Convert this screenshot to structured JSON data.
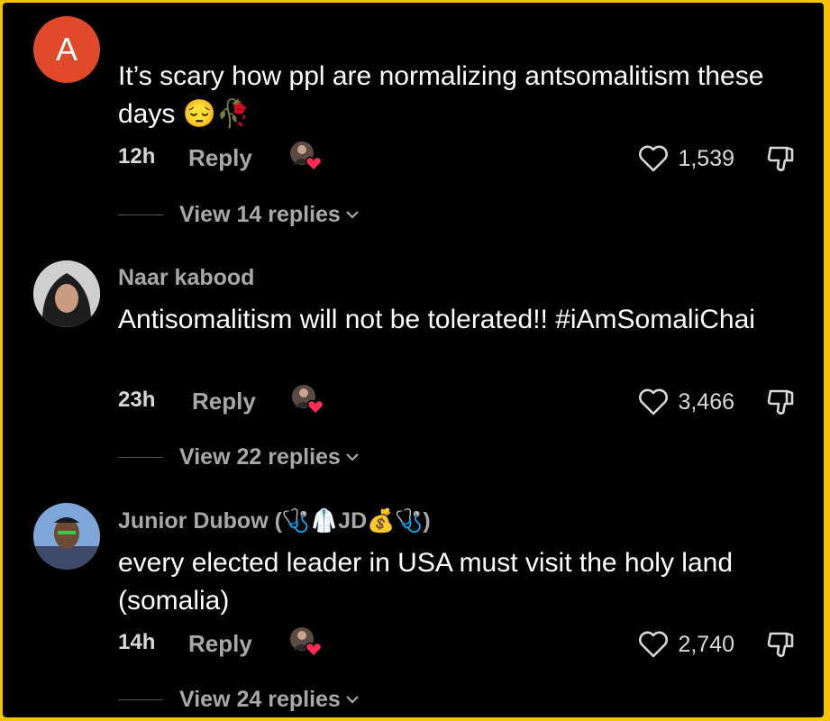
{
  "comments": [
    {
      "avatar_letter": "A",
      "username": "",
      "text": "It’s scary how ppl are normalizing antsomalitism these days 😔🥀",
      "time": "12h",
      "reply_label": "Reply",
      "likes": "1,539",
      "view_replies": "View 14 replies"
    },
    {
      "username": "Naar kabood",
      "text": "Antisomalitism will not be tolerated!! #iAmSomaliChai",
      "time": "23h",
      "reply_label": "Reply",
      "likes": "3,466",
      "view_replies": "View 22 replies"
    },
    {
      "username": "Junior Dubow (🩺🥼JD💰🩺)",
      "text": "every elected leader in USA must visit the holy land (somalia)",
      "time": "14h",
      "reply_label": "Reply",
      "likes": "2,740",
      "view_replies": "View 24 replies"
    }
  ],
  "colors": {
    "background": "#000000",
    "frame": "#f5c400",
    "avatar_letter_bg": "#e04a2a",
    "heart_badge": "#fe2c55"
  },
  "icons": [
    "heart-outline-icon",
    "thumbs-down-icon",
    "chevron-down-icon",
    "liked-by-creator-icon"
  ]
}
